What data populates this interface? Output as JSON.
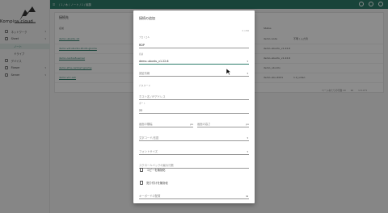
{
  "brand": {
    "name": "Kompira cloud"
  },
  "sidebar": {
    "items": [
      {
        "label": "ネットワーク",
        "caret": "▾",
        "active": false,
        "sub": false
      },
      {
        "label": "Sheet",
        "caret": "▾",
        "active": false,
        "sub": false
      },
      {
        "label": "ノート",
        "caret": "",
        "active": true,
        "sub": true
      },
      {
        "label": "ドライブ",
        "caret": "",
        "active": false,
        "sub": true
      },
      {
        "label": "デバイス",
        "caret": "",
        "active": false,
        "sub": false
      },
      {
        "label": "Flower",
        "caret": "▾",
        "active": false,
        "sub": false
      },
      {
        "label": "Server",
        "caret": "▾",
        "active": false,
        "sub": false
      }
    ]
  },
  "topbar": {
    "breadcrumb": "/ 1 / 木 / ノート / 1 / 編集"
  },
  "background": {
    "title": "接続先",
    "header": "名前",
    "rows": [
      "demo-ubuntu-14",
      "demo-vsf-ubuntu-20-04-gnome",
      "demo-centos8-server",
      "demo-xfce-centos7-gnome",
      "demo-vnc-ssh"
    ],
    "right_header": "Status",
    "right_rows": [
      "demo-node",
      "demo-ubuntu_v1.22.6",
      "demo-ubuntu_v1.22.6",
      "demo_ubuntu",
      "demo-ubu-2021"
    ],
    "right_extra": [
      "不明 / 入力済",
      "",
      "",
      "",
      "1.0_video"
    ],
    "pagination": [
      "ページあたりの行数 10",
      "10",
      "1-5 of 5"
    ]
  },
  "modal": {
    "title": "接続の追加",
    "fields": {
      "protocol_label": "プロトコル",
      "protocol_value": "RDP",
      "protocol_counter": "0 / 256",
      "name_label": "名前",
      "name_value": "demo-ubuntu_v1.22.6",
      "auth_placeholder": "認証情報",
      "password_placeholder": "パスワード",
      "host_placeholder": "ホスト名 / IPアドレス",
      "port_label": "ポート",
      "port_value": "22",
      "width_placeholder": "画面の横幅",
      "width_unit": "px",
      "height_placeholder": "画面の高さ",
      "height_unit": "px",
      "charset_placeholder": "文字コード/言語",
      "font_placeholder": "フォントサイズ",
      "scrollback_placeholder": "スクロールバックの最大行数",
      "copy_disable_label": "コピーを無効化",
      "paste_disable_label": "貼り付けを無効化",
      "keyboard_placeholder": "キーボードの配置",
      "keyboard_icon": "⊞"
    }
  }
}
